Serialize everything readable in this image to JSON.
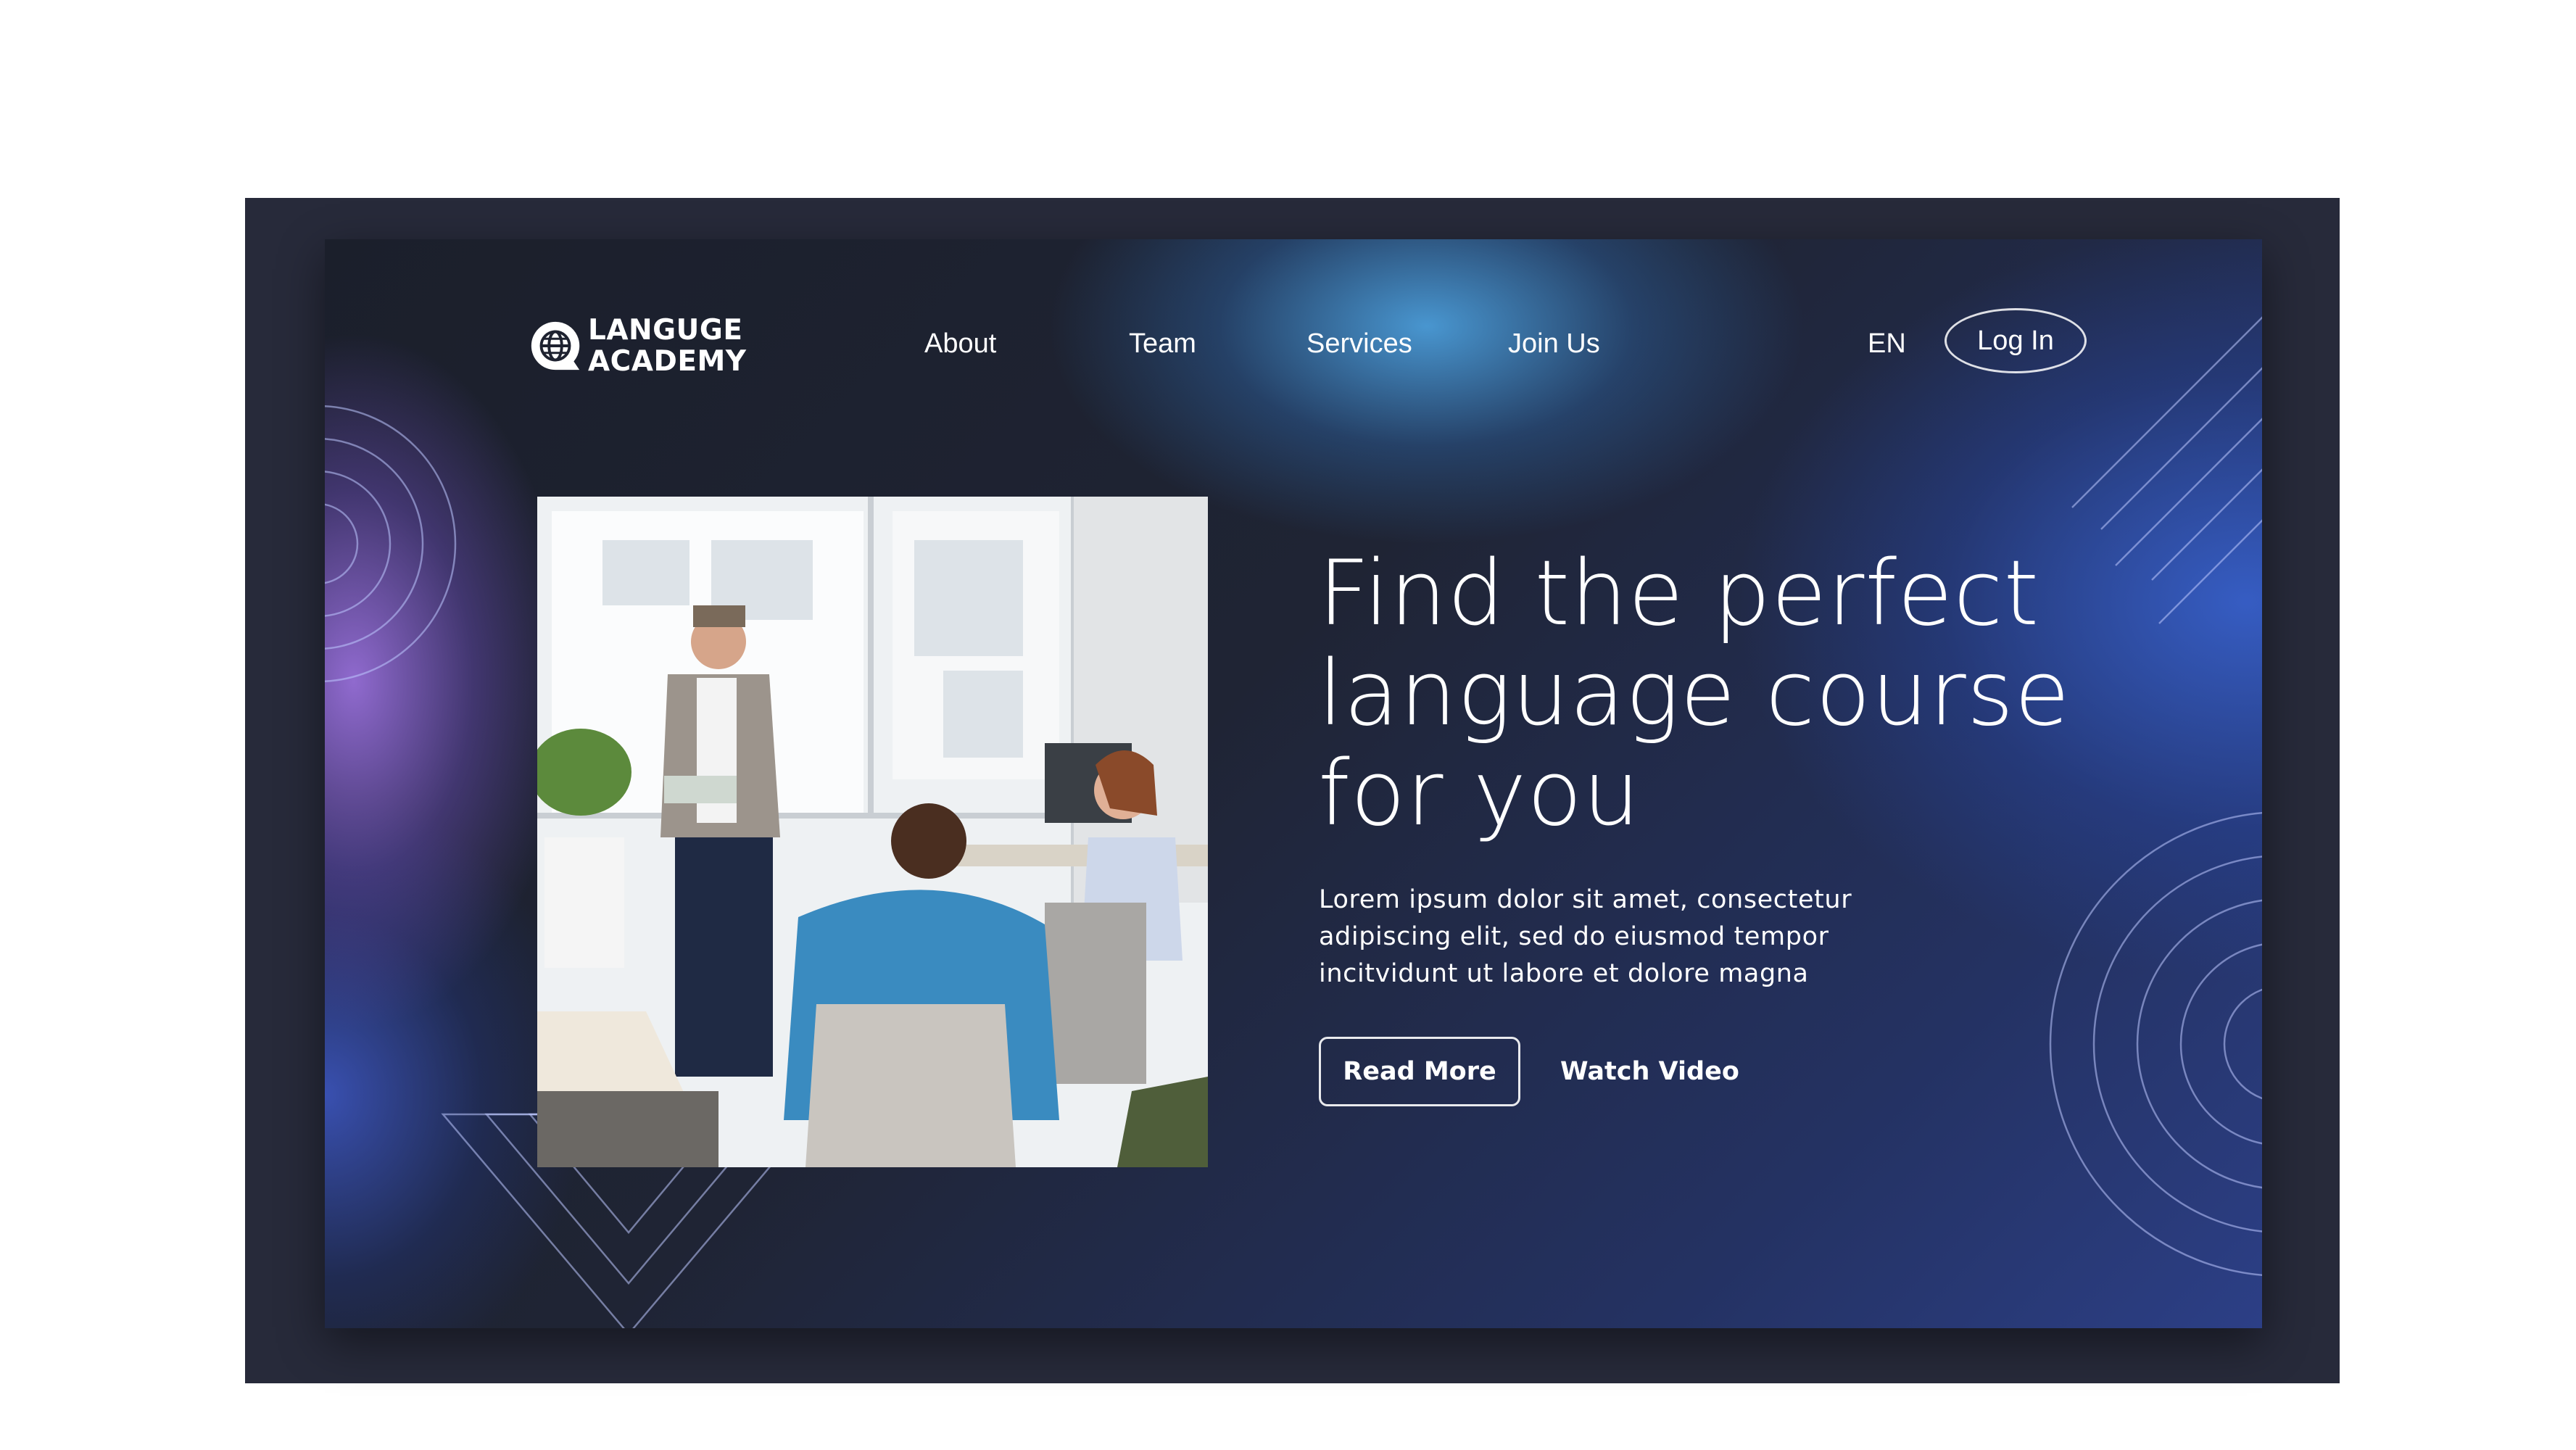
{
  "brand": {
    "line1": "LANGUGE",
    "line2": "ACADEMY",
    "icon": "globe-chat-icon"
  },
  "nav": {
    "items": [
      {
        "label": "About"
      },
      {
        "label": "Team"
      },
      {
        "label": "Services"
      },
      {
        "label": "Join Us"
      }
    ],
    "language": "EN",
    "login_label": "Log In"
  },
  "hero": {
    "headline_line1": "Find the perfect",
    "headline_line2": "language course",
    "headline_line3": "for you",
    "body_line1": "Lorem ipsum dolor sit amet, consectetur",
    "body_line2": "adipiscing elit, sed do eiusmod tempor",
    "body_line3": "incitvidunt ut labore et dolore magna",
    "primary_cta": "Read More",
    "secondary_cta": "Watch Video"
  },
  "colors": {
    "page_bg": "#ffffff",
    "frame_bg": "#272a3a",
    "card_dark": "#1b1f2b",
    "accent_blue": "#3f63c8",
    "accent_purple": "#8e6fd4",
    "text": "#ffffff"
  }
}
